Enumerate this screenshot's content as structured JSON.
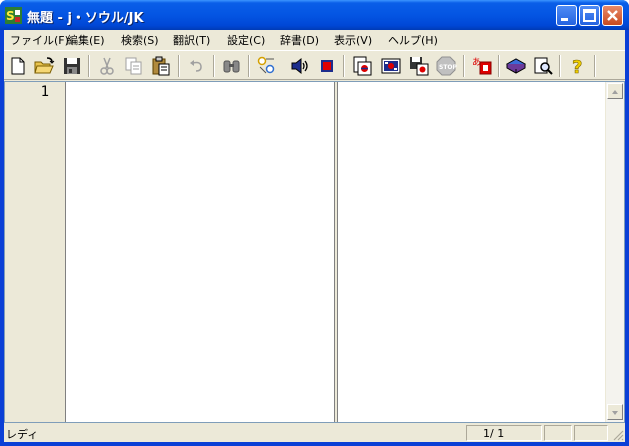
{
  "window": {
    "title": "無題 - j・ソウル/JK"
  },
  "menu": [
    {
      "label": "ファイル(F)"
    },
    {
      "label": "編集(E)"
    },
    {
      "label": "検索(S)"
    },
    {
      "label": "翻訳(T)"
    },
    {
      "label": "設定(C)"
    },
    {
      "label": "辞書(D)"
    },
    {
      "label": "表示(V)"
    },
    {
      "label": "ヘルプ(H)"
    }
  ],
  "toolbar": {
    "icons": [
      "new-file-icon",
      "open-folder-icon",
      "save-icon",
      "cut-icon",
      "copy-icon",
      "paste-icon",
      "undo-icon",
      "find-icon",
      "translate-icon",
      "speak-icon",
      "stop-speak-icon",
      "translate-doc-icon",
      "translate-flag-icon",
      "translate-save-icon",
      "stop-translate-icon",
      "dictionary-register-icon",
      "dictionary-book-icon",
      "dictionary-search-icon",
      "help-icon"
    ]
  },
  "editor": {
    "line_number": "1"
  },
  "status": {
    "state": "レディ",
    "position": "1/ 1"
  }
}
